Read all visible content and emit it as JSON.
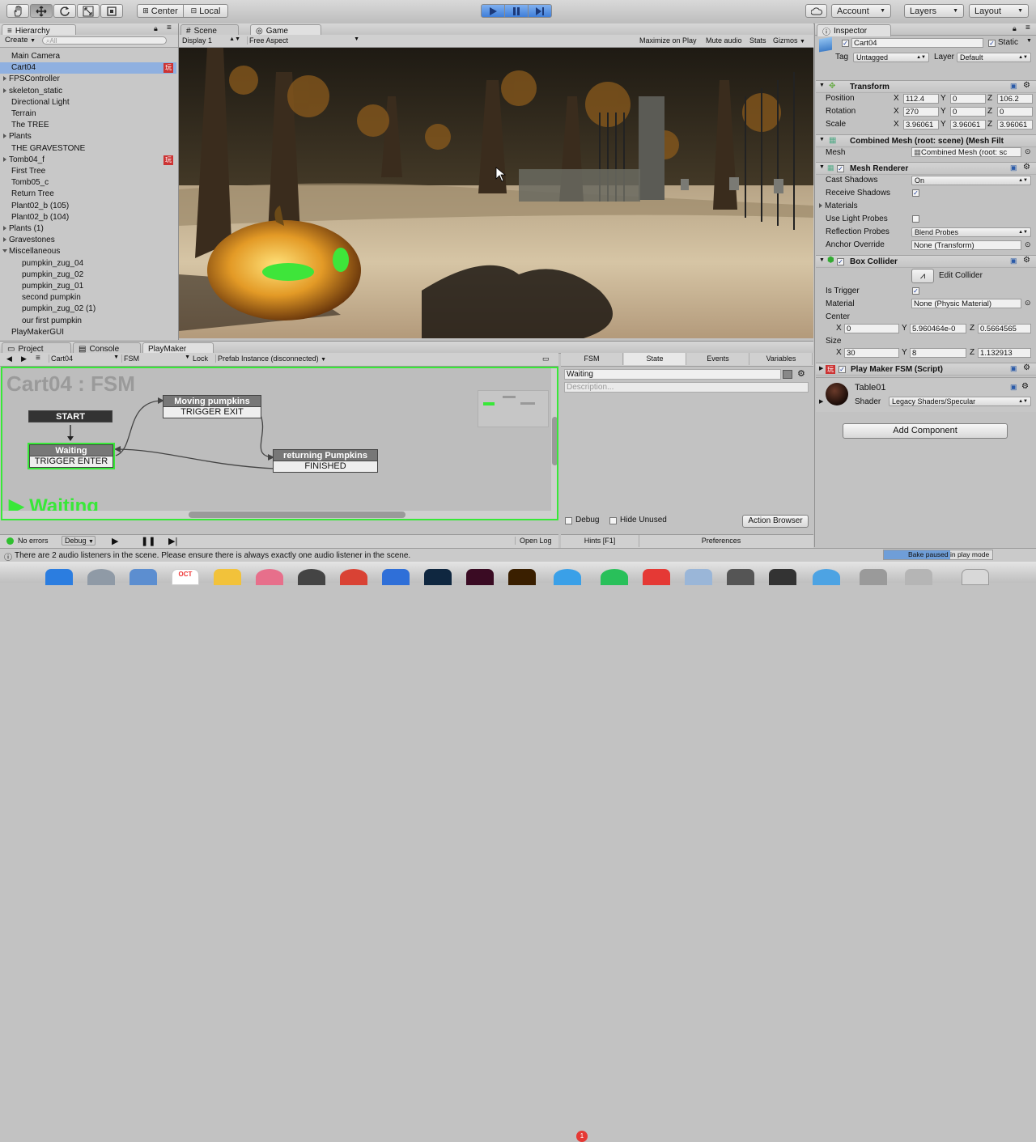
{
  "toolbar": {
    "center_label": "Center",
    "local_label": "Local",
    "account_label": "Account",
    "layers_label": "Layers",
    "layout_label": "Layout"
  },
  "hierarchy": {
    "tab_label": "Hierarchy",
    "create_label": "Create",
    "search_placeholder": "All",
    "items": [
      {
        "label": "Main Camera",
        "indent": 0,
        "arrow": false,
        "selected": false,
        "badge": false
      },
      {
        "label": "Cart04",
        "indent": 0,
        "arrow": false,
        "selected": true,
        "badge": true
      },
      {
        "label": "FPSController",
        "indent": 0,
        "arrow": true,
        "selected": false,
        "badge": false
      },
      {
        "label": "skeleton_static",
        "indent": 0,
        "arrow": true,
        "selected": false,
        "badge": false
      },
      {
        "label": "Directional Light",
        "indent": 0,
        "arrow": false,
        "selected": false,
        "badge": false
      },
      {
        "label": "Terrain",
        "indent": 0,
        "arrow": false,
        "selected": false,
        "badge": false
      },
      {
        "label": "The TREE",
        "indent": 0,
        "arrow": false,
        "selected": false,
        "badge": false
      },
      {
        "label": "Plants",
        "indent": 0,
        "arrow": true,
        "selected": false,
        "badge": false
      },
      {
        "label": "THE GRAVESTONE",
        "indent": 0,
        "arrow": false,
        "selected": false,
        "badge": false
      },
      {
        "label": "Tomb04_f",
        "indent": 0,
        "arrow": true,
        "selected": false,
        "badge": true
      },
      {
        "label": "First Tree",
        "indent": 0,
        "arrow": false,
        "selected": false,
        "badge": false
      },
      {
        "label": "Tomb05_c",
        "indent": 0,
        "arrow": false,
        "selected": false,
        "badge": false
      },
      {
        "label": "Return Tree",
        "indent": 0,
        "arrow": false,
        "selected": false,
        "badge": false
      },
      {
        "label": "Plant02_b (105)",
        "indent": 0,
        "arrow": false,
        "selected": false,
        "badge": false
      },
      {
        "label": "Plant02_b (104)",
        "indent": 0,
        "arrow": false,
        "selected": false,
        "badge": false
      },
      {
        "label": "Plants (1)",
        "indent": 0,
        "arrow": true,
        "selected": false,
        "badge": false
      },
      {
        "label": "Gravestones",
        "indent": 0,
        "arrow": true,
        "selected": false,
        "badge": false
      },
      {
        "label": "Miscellaneous",
        "indent": 0,
        "arrow": true,
        "selected": false,
        "badge": false,
        "open": true
      },
      {
        "label": "pumpkin_zug_04",
        "indent": 1,
        "arrow": false,
        "selected": false,
        "badge": false
      },
      {
        "label": "pumpkin_zug_02",
        "indent": 1,
        "arrow": false,
        "selected": false,
        "badge": false
      },
      {
        "label": "pumpkin_zug_01",
        "indent": 1,
        "arrow": false,
        "selected": false,
        "badge": false
      },
      {
        "label": "second pumpkin",
        "indent": 1,
        "arrow": false,
        "selected": false,
        "badge": false
      },
      {
        "label": "pumpkin_zug_02 (1)",
        "indent": 1,
        "arrow": false,
        "selected": false,
        "badge": false
      },
      {
        "label": "our first pumpkin",
        "indent": 1,
        "arrow": false,
        "selected": false,
        "badge": false
      },
      {
        "label": "PlayMakerGUI",
        "indent": 0,
        "arrow": false,
        "selected": false,
        "badge": false
      }
    ]
  },
  "scene_tabs": {
    "scene": "Scene",
    "game": "Game"
  },
  "game_bar": {
    "display": "Display 1",
    "aspect": "Free Aspect",
    "maximize": "Maximize on Play",
    "mute": "Mute audio",
    "stats": "Stats",
    "gizmos": "Gizmos"
  },
  "bottom_tabs": {
    "project": "Project",
    "console": "Console",
    "playmaker": "PlayMaker"
  },
  "fsm_bar": {
    "object": "Cart04",
    "fsm": "FSM",
    "lock": "Lock",
    "prefab": "Prefab Instance (disconnected)"
  },
  "fsm_graph": {
    "title": "Cart04 : FSM",
    "start": "START",
    "states": [
      {
        "name": "Waiting",
        "event": "TRIGGER ENTER"
      },
      {
        "name": "Moving pumpkins",
        "event": "TRIGGER EXIT"
      },
      {
        "name": "returning Pumpkins",
        "event": "FINISHED"
      }
    ],
    "active_state": "Waiting",
    "no_errors": "No errors",
    "debug": "Debug",
    "open_log": "Open Log"
  },
  "fsm_inspector": {
    "tabs": [
      "FSM",
      "State",
      "Events",
      "Variables"
    ],
    "state_name": "Waiting",
    "description_placeholder": "Description...",
    "debug": "Debug",
    "hide_unused": "Hide Unused",
    "action_browser": "Action Browser",
    "hints": "Hints [F1]",
    "preferences": "Preferences"
  },
  "inspector": {
    "tab_label": "Inspector",
    "object_name": "Cart04",
    "static_label": "Static",
    "tag_label": "Tag",
    "tag_value": "Untagged",
    "layer_label": "Layer",
    "layer_value": "Default",
    "transform": {
      "title": "Transform",
      "position_label": "Position",
      "rotation_label": "Rotation",
      "scale_label": "Scale",
      "position": [
        "112.4",
        "0",
        "106.2"
      ],
      "rotation": [
        "270",
        "0",
        "0"
      ],
      "scale": [
        "3.96061",
        "3.96061",
        "3.96061"
      ]
    },
    "mesh_filter": {
      "title": "Combined Mesh (root: scene) (Mesh Filt",
      "mesh_label": "Mesh",
      "mesh_value": "Combined Mesh (root: sc"
    },
    "mesh_renderer": {
      "title": "Mesh Renderer",
      "cast_shadows_label": "Cast Shadows",
      "cast_shadows_value": "On",
      "receive_shadows_label": "Receive Shadows",
      "materials_label": "Materials",
      "light_probes_label": "Use Light Probes",
      "reflection_label": "Reflection Probes",
      "reflection_value": "Blend Probes",
      "anchor_label": "Anchor Override",
      "anchor_value": "None (Transform)"
    },
    "box_collider": {
      "title": "Box Collider",
      "edit_collider": "Edit Collider",
      "is_trigger_label": "Is Trigger",
      "material_label": "Material",
      "material_value": "None (Physic Material)",
      "center_label": "Center",
      "center": [
        "0",
        "5.960464e-0",
        "0.5664565"
      ],
      "size_label": "Size",
      "size": [
        "30",
        "8",
        "1.132913"
      ]
    },
    "playmaker_fsm": {
      "title": "Play Maker FSM (Script)"
    },
    "material": {
      "name": "Table01",
      "shader_label": "Shader",
      "shader_value": "Legacy Shaders/Specular"
    },
    "add_component": "Add Component",
    "x": "X",
    "y": "Y",
    "z": "Z"
  },
  "status_bar": {
    "message": "There are 2 audio listeners in the scene. Please ensure there is always exactly one audio listener in the scene.",
    "bake": "Bake paused in play mode"
  },
  "dock": {
    "calendar_month": "OCT",
    "notification_count": "1"
  },
  "colors": {
    "accent_green": "#38e838",
    "selection": "#8fb0e0",
    "play_blue": "#3f7ed8"
  }
}
